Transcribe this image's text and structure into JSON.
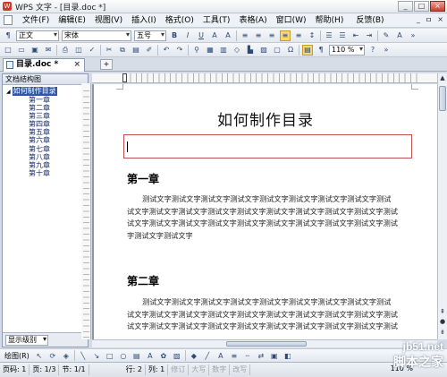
{
  "window": {
    "title": "WPS 文字 - [目录.doc *]",
    "app_icon_label": "W"
  },
  "menu": {
    "items": [
      "文件(F)",
      "编辑(E)",
      "视图(V)",
      "插入(I)",
      "格式(O)",
      "工具(T)",
      "表格(A)",
      "窗口(W)",
      "帮助(H)",
      "反馈(B)"
    ],
    "right": [
      "_",
      "ㅁ",
      "×"
    ]
  },
  "format_toolbar": {
    "style": "正文",
    "font": "宋体",
    "size": "五号"
  },
  "standard_toolbar": {
    "zoom": "110 %"
  },
  "tabs": {
    "doc_tab": "目录.doc *",
    "close_glyph": "×"
  },
  "navpane": {
    "header": "文档结构图",
    "root": "如何制作目录",
    "chapters": [
      "第一章",
      "第二章",
      "第三章",
      "第四章",
      "第五章",
      "第六章",
      "第七章",
      "第八章",
      "第九章",
      "第十章"
    ],
    "mode_label": "显示级别"
  },
  "document": {
    "title": "如何制作目录",
    "chapter1": {
      "heading": "第一章",
      "lines": [
        "测试文字测试文字测试文字测试文字测试文字测试文字测试文字测试文字测试",
        "试文字测试文字测试文字测试文字测试文字测试文字测试文字测试文字测试文字测试",
        "试文字测试文字测试文字测试文字测试文字测试文字测试文字测试文字测试文字测试",
        "字测试文字测试文字"
      ]
    },
    "chapter2": {
      "heading": "第二章",
      "lines": [
        "测试文字测试文字测试文字测试文字测试文字测试文字测试文字测试文字测试",
        "试文字测试文字测试文字测试文字测试文字测试文字测试文字测试文字测试文字测试",
        "试文字测试文字测试文字测试文字测试文字测试文字测试文字测试文字测试文字测试"
      ]
    }
  },
  "drawbar": {
    "label": "绘图(R)"
  },
  "status": {
    "page": "页码: 1",
    "pages": "页: 1/3",
    "section": "节: 1/1",
    "row": "行: 2",
    "col": "列: 1",
    "rev": "修订",
    "caps": "大写",
    "num": "数字",
    "ovr": "改写",
    "zoom": "110 %"
  },
  "watermark": {
    "site": "jb51.net",
    "name": "脚本之家"
  },
  "colors": {
    "toc_box_border": "#c0504d",
    "nav_selected": "#2f56a8",
    "active_button": "#f7d57a"
  }
}
